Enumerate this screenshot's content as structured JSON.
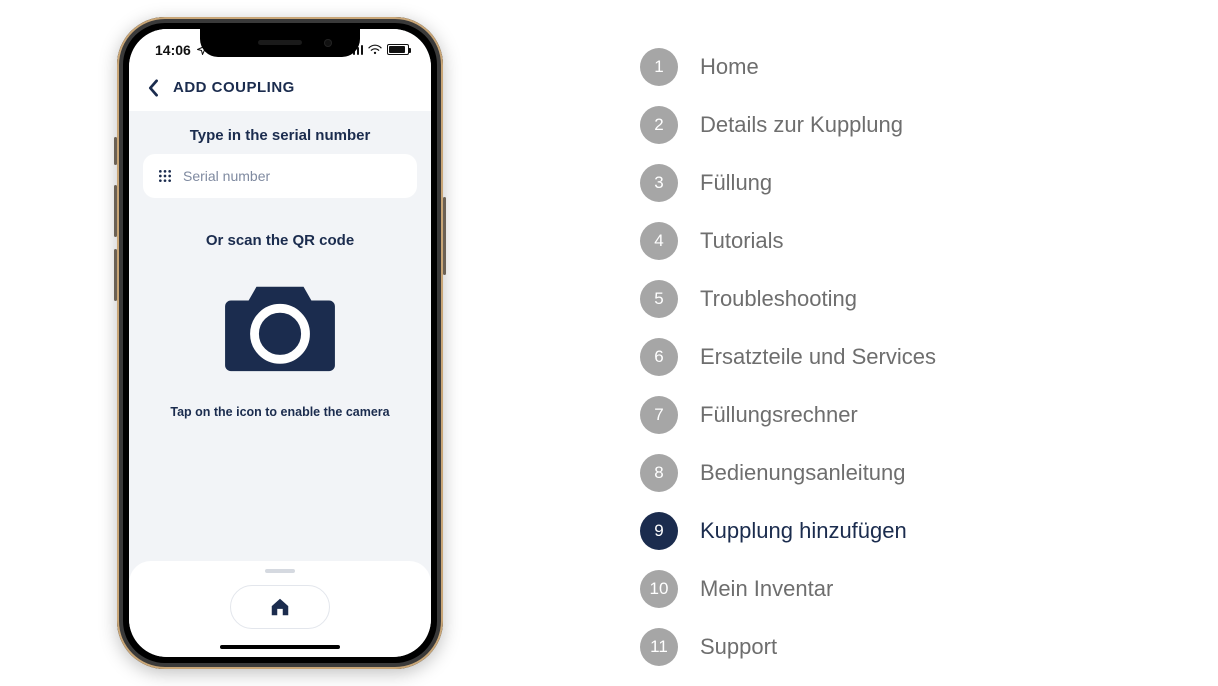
{
  "status": {
    "time": "14:06",
    "location_icon": "location-arrow"
  },
  "header": {
    "title": "ADD COUPLING"
  },
  "content": {
    "serial_prompt": "Type in the serial number",
    "serial_placeholder": "Serial number",
    "or_prompt": "Or scan the QR code",
    "tap_hint": "Tap on the icon to enable the camera"
  },
  "menu": {
    "active_index": 8,
    "items": [
      {
        "num": "1",
        "label": "Home"
      },
      {
        "num": "2",
        "label": "Details zur Kupplung"
      },
      {
        "num": "3",
        "label": "Füllung"
      },
      {
        "num": "4",
        "label": "Tutorials"
      },
      {
        "num": "5",
        "label": "Troubleshooting"
      },
      {
        "num": "6",
        "label": "Ersatzteile und Services"
      },
      {
        "num": "7",
        "label": "Füllungsrechner"
      },
      {
        "num": "8",
        "label": "Bedienungsanleitung"
      },
      {
        "num": "9",
        "label": "Kupplung hinzufügen"
      },
      {
        "num": "10",
        "label": "Mein Inventar"
      },
      {
        "num": "11",
        "label": "Support"
      }
    ]
  },
  "colors": {
    "primary": "#1b2c4e",
    "muted": "#a6a6a6",
    "text_muted": "#6e6e6e"
  }
}
